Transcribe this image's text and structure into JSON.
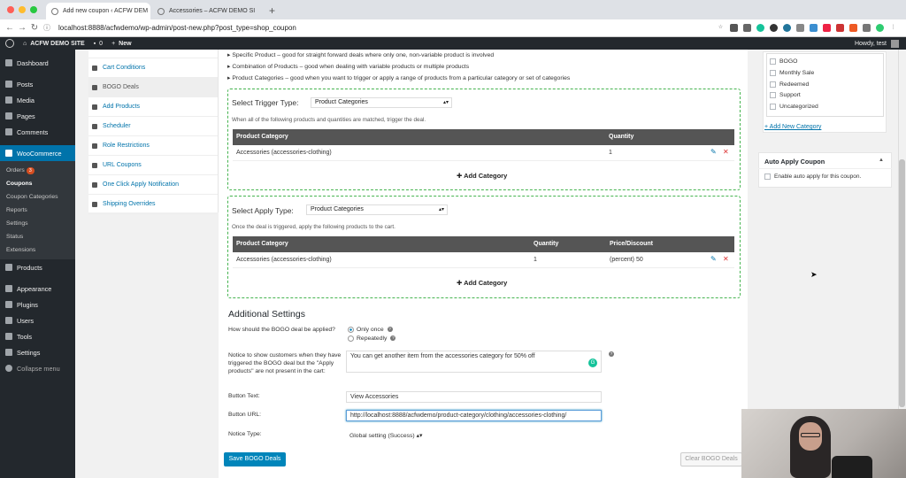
{
  "browser": {
    "tabs": [
      {
        "title": "Add new coupon ‹ ACFW DEM",
        "active": true
      },
      {
        "title": "Accessories – ACFW DEMO SI",
        "active": false
      }
    ],
    "url": "localhost:8888/acfwdemo/wp-admin/post-new.php?post_type=shop_coupon"
  },
  "adminbar": {
    "site": "ACFW DEMO SITE",
    "comments": "0",
    "new": "New",
    "howdy": "Howdy, test"
  },
  "sidebar": {
    "items": [
      {
        "label": "Dashboard"
      },
      {
        "label": "Posts"
      },
      {
        "label": "Media"
      },
      {
        "label": "Pages"
      },
      {
        "label": "Comments"
      }
    ],
    "woocommerce": "WooCommerce",
    "wc_sub": [
      {
        "label": "Orders",
        "badge": "3"
      },
      {
        "label": "Coupons"
      },
      {
        "label": "Coupon Categories"
      },
      {
        "label": "Reports"
      },
      {
        "label": "Settings"
      },
      {
        "label": "Status"
      },
      {
        "label": "Extensions"
      }
    ],
    "items2": [
      {
        "label": "Products"
      },
      {
        "label": "Appearance"
      },
      {
        "label": "Plugins"
      },
      {
        "label": "Users"
      },
      {
        "label": "Tools"
      },
      {
        "label": "Settings"
      },
      {
        "label": "Collapse menu"
      }
    ]
  },
  "coupon_tabs": [
    {
      "label": "Cart Conditions"
    },
    {
      "label": "BOGO Deals"
    },
    {
      "label": "Add Products"
    },
    {
      "label": "Scheduler"
    },
    {
      "label": "Role Restrictions"
    },
    {
      "label": "URL Coupons"
    },
    {
      "label": "One Click Apply Notification"
    },
    {
      "label": "Shipping Overrides"
    }
  ],
  "bogo": {
    "desc": [
      "Specific Product – good for straight forward deals where only one, non-variable product is involved",
      "Combination of Products – good when dealing with variable products or multiple products",
      "Product Categories – good when you want to trigger or apply a range of products from a particular category or set of categories"
    ],
    "trigger": {
      "label": "Select Trigger Type:",
      "value": "Product Categories",
      "note": "When all of the following products and quantities are matched, trigger the deal.",
      "headers": [
        "Product Category",
        "Quantity"
      ],
      "rows": [
        {
          "category": "Accessories (accessories-clothing)",
          "qty": "1"
        }
      ],
      "add": "Add Category"
    },
    "apply": {
      "label": "Select Apply Type:",
      "value": "Product Categories",
      "note": "Once the deal is triggered, apply the following products to the cart.",
      "headers": [
        "Product Category",
        "Quantity",
        "Price/Discount"
      ],
      "rows": [
        {
          "category": "Accessories (accessories-clothing)",
          "qty": "1",
          "price": "(percent) 50"
        }
      ],
      "add": "Add Category"
    },
    "additional": {
      "title": "Additional Settings",
      "how_label": "How should the BOGO deal be applied?",
      "opt_once": "Only once",
      "opt_repeat": "Repeatedly",
      "notice_label": "Notice to show customers when they have triggered the BOGO deal but the \"Apply products\" are not present in the cart:",
      "notice_value": "You can get another item from the accessories category for 50% off",
      "button_text_label": "Button Text:",
      "button_text_value": "View Accessories",
      "button_url_label": "Button URL:",
      "button_url_value": "http://localhost:8888/acfwdemo/product-category/clothing/accessories-clothing/",
      "notice_type_label": "Notice Type:",
      "notice_type_value": "Global setting (Success)"
    },
    "save": "Save BOGO Deals",
    "clear": "Clear BOGO Deals"
  },
  "categories": [
    "BOGO",
    "Monthly Sale",
    "Redeemed",
    "Support",
    "Uncategorized"
  ],
  "add_new_category": "+ Add New Category",
  "auto_apply": {
    "title": "Auto Apply Coupon",
    "checkbox": "Enable auto apply for this coupon."
  }
}
